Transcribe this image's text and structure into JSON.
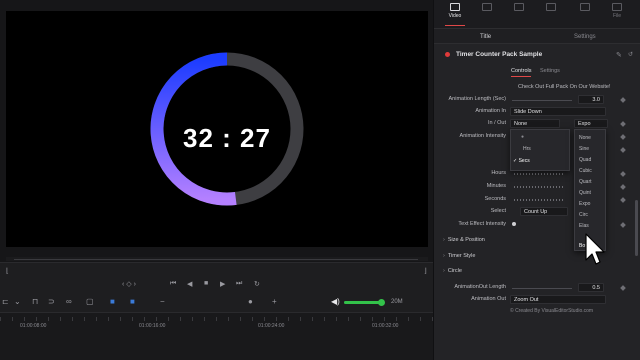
{
  "viewer": {
    "timer_text": "32 : 27",
    "ring": {
      "progress_fraction": 0.52,
      "gradient_start": "#1c3cff",
      "gradient_end": "#b480ff",
      "track_color": "#3e3e42"
    }
  },
  "timeline": {
    "timecodes": [
      "01:00:08:00",
      "01:00:16:00",
      "01:00:24:00",
      "01:00:32:00"
    ],
    "volume_label": "20M",
    "volume_level_fraction": 0.95
  },
  "inspector": {
    "tabs": [
      {
        "label": "Video",
        "icon": "video-icon",
        "active": true
      },
      {
        "label": "",
        "icon": "audio-icon",
        "active": false
      },
      {
        "label": "",
        "icon": "effects-icon",
        "active": false
      },
      {
        "label": "",
        "icon": "transition-icon",
        "active": false
      },
      {
        "label": "",
        "icon": "image-icon",
        "active": false
      },
      {
        "label": "File",
        "icon": "file-icon",
        "active": false
      }
    ],
    "subtabs": {
      "title": "Title",
      "settings": "Settings"
    },
    "effect_title": "Timer Counter Pack Sample",
    "control_tabs": {
      "controls": "Controls",
      "settings": "Settings"
    },
    "promo": "Check Out Full Pack On Our Website!",
    "fields": {
      "animation_length_label": "Animation Length (Sec)",
      "animation_length_value": "3.0",
      "animation_in_label": "Animation In",
      "animation_in_value": "Slide Down",
      "in_out_label": "In / Out",
      "in_out_value": "None",
      "expo_value": "Expo",
      "animation_intensity_label": "Animation Intensity",
      "hours_label": "Hours",
      "minutes_label": "Minutes",
      "seconds_label": "Seconds",
      "select_label": "Select",
      "select_value": "Count Up",
      "text_effect_label": "Text Effect Intensity",
      "animation_out_length_label": "AnimationOut Length",
      "animation_out_length_value": "0.5",
      "animation_out_label": "Animation Out",
      "animation_out_value": "Zoom Out"
    },
    "sections": [
      "Size & Position",
      "Timer Style",
      "Circle"
    ],
    "units_menu": {
      "items": [
        "Hrs",
        "Secs"
      ],
      "checked": "Secs"
    },
    "easing_menu": {
      "items": [
        "None",
        "Sine",
        "Quad",
        "Cubic",
        "Quart",
        "Quint",
        "Expo",
        "Circ",
        "Elas",
        "",
        "Bou"
      ]
    },
    "credit": "© Created By VisualEditorStudio.com"
  }
}
